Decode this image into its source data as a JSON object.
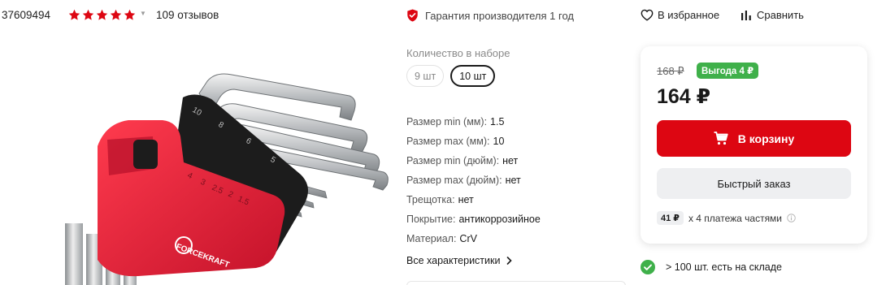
{
  "header": {
    "sku": "37609494",
    "rating": {
      "stars": 5,
      "value_of": 5
    },
    "reviews_label": "109 отзывов",
    "guarantee_label": "Гарантия производителя 1 год",
    "favorites_label": "В избранное",
    "compare_label": "Сравнить"
  },
  "image": {
    "brand_text": "FORCEKRAFT",
    "key_markings": [
      "10",
      "8",
      "6",
      "5",
      "4",
      "3",
      "2.5",
      "2",
      "1.5"
    ]
  },
  "options": {
    "label": "Количество в наборе",
    "items": [
      {
        "label": "9 шт",
        "selected": false
      },
      {
        "label": "10 шт",
        "selected": true
      }
    ]
  },
  "specs": [
    {
      "name": "Размер min (мм):",
      "value": "1.5"
    },
    {
      "name": "Размер max (мм):",
      "value": "10"
    },
    {
      "name": "Размер min (дюйм):",
      "value": "нет"
    },
    {
      "name": "Размер max (дюйм):",
      "value": "нет"
    },
    {
      "name": "Трещотка:",
      "value": "нет"
    },
    {
      "name": "Покрытие:",
      "value": "антикоррозийное"
    },
    {
      "name": "Материал:",
      "value": "CrV"
    }
  ],
  "all_specs_label": "Все характеристики",
  "buy": {
    "old_price": "168 ₽",
    "benefit": "Выгода 4 ₽",
    "price": "164 ₽",
    "cart_label": "В корзину",
    "quick_order_label": "Быстрый заказ",
    "installment_amount": "41 ₽",
    "installment_text": "х 4 платежа частями"
  },
  "stock_label": "> 100 шт. есть на складе",
  "colors": {
    "accent_red": "#dd0612",
    "star_red": "#dd0612",
    "benefit_green": "#3fb04a",
    "stock_green": "#3fb04a"
  },
  "icons": [
    "star-icon",
    "caret-down-icon",
    "shield-icon",
    "heart-icon",
    "compare-bars-icon",
    "chevron-right-icon",
    "cart-icon",
    "info-icon",
    "check-circle-icon"
  ]
}
